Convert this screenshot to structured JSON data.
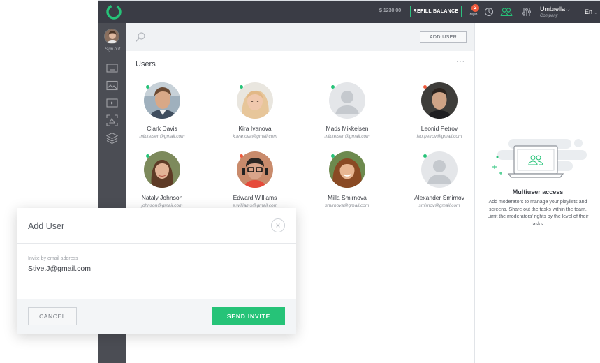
{
  "topbar": {
    "balance": "$ 1230,00",
    "refill_label": "REFILL BALANCE",
    "notifications_count": "2",
    "company_name": "Umbrella",
    "company_sub": "Company",
    "language": "En"
  },
  "sidebar": {
    "signout_label": "Sign out",
    "icons": [
      "screens-icon",
      "images-icon",
      "video-icon",
      "scan-icon",
      "layers-icon"
    ]
  },
  "main": {
    "add_user_label": "ADD USER",
    "users_title": "Users",
    "more_label": "···",
    "users": [
      {
        "name": "Clark Davis",
        "email": "mikkelsen@gmail.com",
        "status": "online"
      },
      {
        "name": "Kira Ivanova",
        "email": "k.ivanova@gmail.com",
        "status": "online"
      },
      {
        "name": "Mads Mikkelsen",
        "email": "mikkelsen@gmail.com",
        "status": "online"
      },
      {
        "name": "Leonid Petrov",
        "email": "leo.petrov@gmail.com",
        "status": "away"
      },
      {
        "name": "Nataly Johnson",
        "email": "johnson@gmail.com",
        "status": "online"
      },
      {
        "name": "Edward Williams",
        "email": "e.williams@gmail.com",
        "status": "away"
      },
      {
        "name": "Milla Smirnova",
        "email": "smirnova@gmail.com",
        "status": "online"
      },
      {
        "name": "Alexander Smirnov",
        "email": "smirnov@gmail.com",
        "status": "online"
      }
    ]
  },
  "right_panel": {
    "title": "Multiuser access",
    "description": "Add moderators to manage your playlists and screens. Share out the tasks within the team. Limit the moderators' rights by the level of their tasks."
  },
  "modal": {
    "title": "Add User",
    "field_label": "Invite by email address",
    "field_value": "Stive.J@gmail.com",
    "cancel_label": "CANCEL",
    "send_label": "SEND INVITE"
  },
  "colors": {
    "accent": "#26c378",
    "topbar": "#3a3c45",
    "sidebar": "#4b4d54",
    "status_online": "#26c378",
    "status_away": "#ef5a3c"
  }
}
